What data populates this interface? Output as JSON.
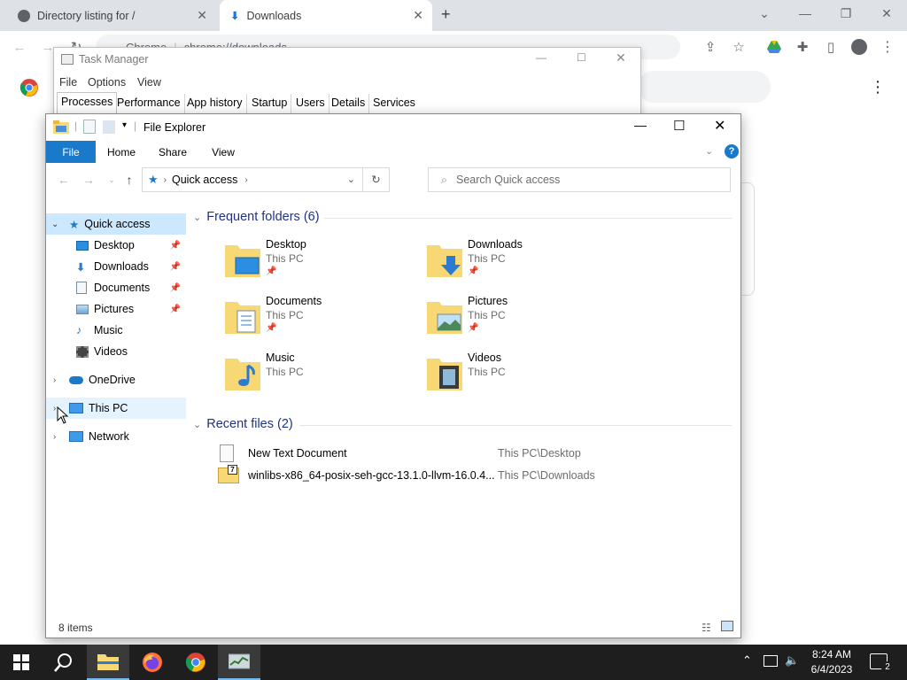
{
  "chrome": {
    "tabs": [
      {
        "label": "Directory listing for /"
      },
      {
        "label": "Downloads"
      }
    ],
    "url_scheme": "Chrome",
    "url_path": "chrome://downloads"
  },
  "task_manager": {
    "title": "Task Manager",
    "menu": [
      "File",
      "Options",
      "View"
    ],
    "tabs": [
      "Processes",
      "Performance",
      "App history",
      "Startup",
      "Users",
      "Details",
      "Services"
    ]
  },
  "explorer": {
    "title": "File Explorer",
    "ribbon": [
      "File",
      "Home",
      "Share",
      "View"
    ],
    "breadcrumb": "Quick access",
    "search_placeholder": "Search Quick access",
    "nav": {
      "quick_access": "Quick access",
      "pinned": [
        "Desktop",
        "Downloads",
        "Documents",
        "Pictures",
        "Music",
        "Videos"
      ],
      "onedrive": "OneDrive",
      "this_pc": "This PC",
      "network": "Network"
    },
    "frequent_header": "Frequent folders (6)",
    "frequent": [
      {
        "name": "Desktop",
        "loc": "This PC",
        "pinned": true,
        "icon": "desktop-folder-icon"
      },
      {
        "name": "Downloads",
        "loc": "This PC",
        "pinned": true,
        "icon": "downloads-folder-icon"
      },
      {
        "name": "Documents",
        "loc": "This PC",
        "pinned": true,
        "icon": "documents-folder-icon"
      },
      {
        "name": "Pictures",
        "loc": "This PC",
        "pinned": true,
        "icon": "pictures-folder-icon"
      },
      {
        "name": "Music",
        "loc": "This PC",
        "pinned": false,
        "icon": "music-folder-icon"
      },
      {
        "name": "Videos",
        "loc": "This PC",
        "pinned": false,
        "icon": "videos-folder-icon"
      }
    ],
    "recent_header": "Recent files (2)",
    "recent": [
      {
        "name": "New Text Document",
        "loc": "This PC\\Desktop"
      },
      {
        "name": "winlibs-x86_64-posix-seh-gcc-13.1.0-llvm-16.0.4...",
        "loc": "This PC\\Downloads"
      }
    ],
    "status": "8 items"
  },
  "taskbar": {
    "time": "8:24 AM",
    "date": "6/4/2023",
    "notif_count": "2"
  },
  "colors": {
    "accent": "#1979ca",
    "folder_yellow": "#f8d775",
    "taskbar": "#1e1e1e"
  }
}
